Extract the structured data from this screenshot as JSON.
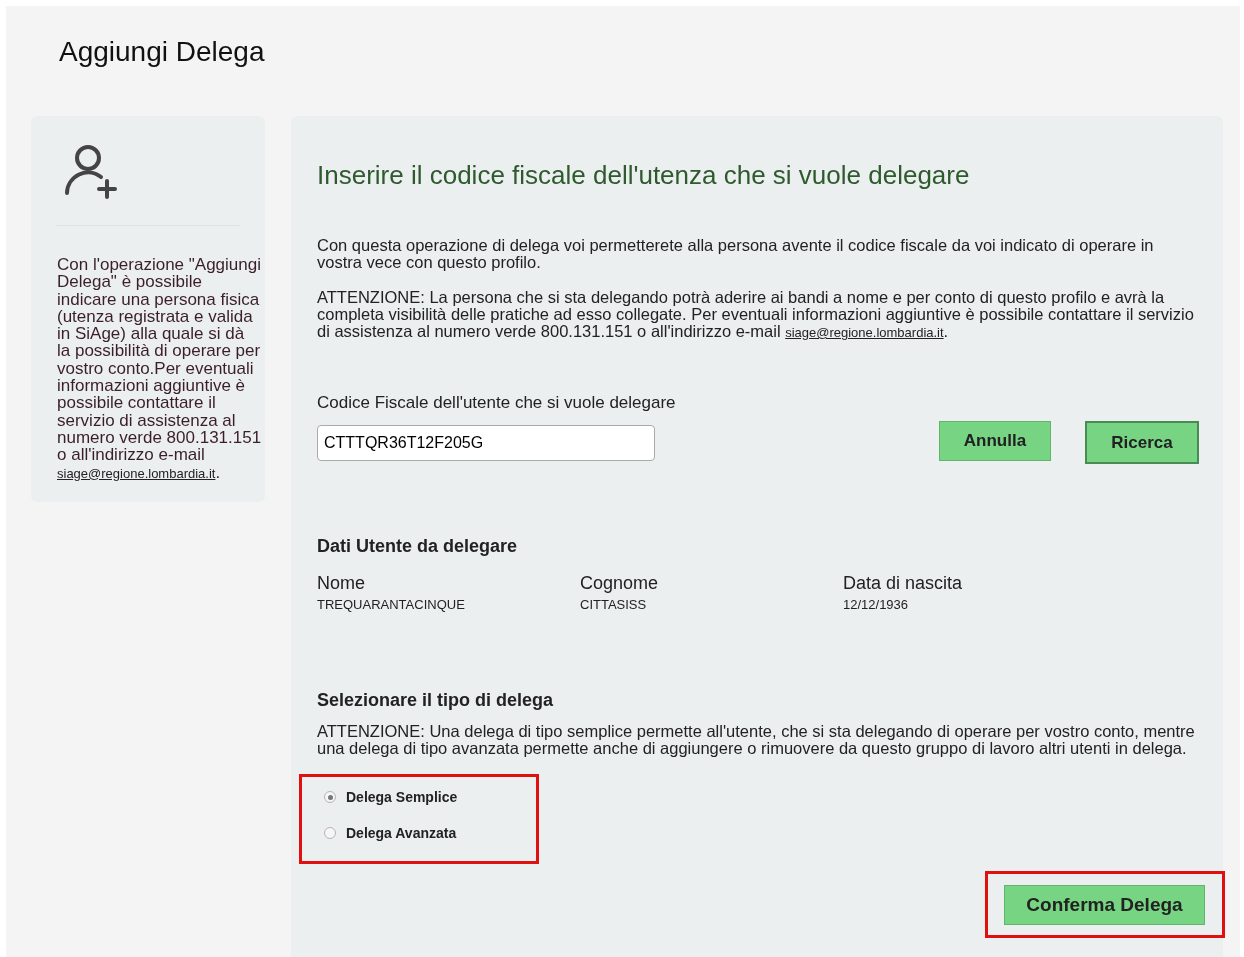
{
  "page_title": "Aggiungi Delega",
  "sidebar": {
    "text": "Con l'operazione \"Aggiungi Delega\" è possibile indicare una persona fisica (utenza registrata e valida in SiAge) alla quale si dà la possibilità di operare per vostro conto.Per eventuali informazioni aggiuntive è possibile contattare il servizio di assistenza al numero verde 800.131.151 o all'indirizzo e-mail ",
    "link": "siage@regione.lombardia.it",
    "after_link": "."
  },
  "main": {
    "heading": "Inserire il codice fiscale dell'utenza che si vuole delegare",
    "intro": "Con questa operazione di delega voi permetterete alla persona avente il codice fiscale da voi indicato di operare in vostra vece con questo profilo.",
    "warning": "ATTENZIONE: La persona che si sta delegando potrà aderire ai bandi a nome e per conto di questo profilo e avrà la completa visibilità delle pratiche ad esso collegate. Per eventuali informazioni aggiuntive è possibile contattare il servizio di assistenza al numero verde 800.131.151 o all'indirizzo e-mail ",
    "warning_link": "siage@regione.lombardia.it",
    "warning_after": ".",
    "field_label": "Codice Fiscale dell'utente che si vuole delegare",
    "field_value": "CTTTQR36T12F205G",
    "buttons": [
      {
        "label": "Annulla",
        "focused": false
      },
      {
        "label": "Ricerca",
        "focused": true
      }
    ],
    "user_section": {
      "title": "Dati Utente da delegare",
      "fields": [
        {
          "label": "Nome",
          "value": "TREQUARANTACINQUE"
        },
        {
          "label": "Cognome",
          "value": "CITTASISS"
        },
        {
          "label": "Data di nascita",
          "value": "12/12/1936"
        }
      ]
    },
    "type_section": {
      "title": "Selezionare il tipo di delega",
      "warning": "ATTENZIONE: Una delega di tipo semplice permette all'utente, che si sta delegando di operare per vostro conto, mentre una delega di tipo avanzata permette anche di aggiungere o rimuovere da questo gruppo di lavoro altri utenti in delega.",
      "options": [
        {
          "label": "Delega Semplice",
          "selected": true
        },
        {
          "label": "Delega Avanzata",
          "selected": false
        }
      ],
      "highlighted": true
    },
    "confirm": {
      "label": "Conferma Delega",
      "highlighted": true
    }
  }
}
